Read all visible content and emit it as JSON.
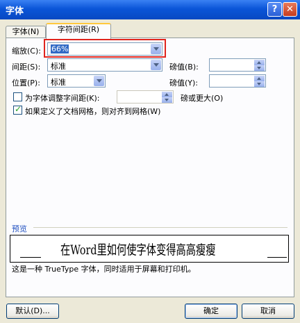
{
  "window": {
    "title": "字体",
    "help_icon": "?",
    "close_icon": "✕"
  },
  "tabs": [
    {
      "label": "字体(N)"
    },
    {
      "label": "字符间距(R)"
    }
  ],
  "scale": {
    "label": "缩放(C):",
    "value": "66%"
  },
  "spacing": {
    "label": "间距(S):",
    "value": "标准",
    "by_label": "磅值(B):",
    "by_value": ""
  },
  "position": {
    "label": "位置(P):",
    "value": "标准",
    "by_label": "磅值(Y):",
    "by_value": ""
  },
  "kerning": {
    "label": "为字体调整字间距(K):",
    "checked": false,
    "value": "",
    "suffix": "磅或更大(O)"
  },
  "grid": {
    "label": "如果定义了文档网格，则对齐到网格(W)",
    "checked": true
  },
  "preview": {
    "label": "预览",
    "text": "在Word里如何使字体变得高高瘦瘦",
    "note": "这是一种 TrueType 字体，同时适用于屏幕和打印机。"
  },
  "buttons": {
    "default": "默认(D)...",
    "ok": "确定",
    "cancel": "取消"
  },
  "colors": {
    "titlebar": "#0a55d8",
    "highlight": "#e0251d",
    "checkmark": "#21a121"
  }
}
